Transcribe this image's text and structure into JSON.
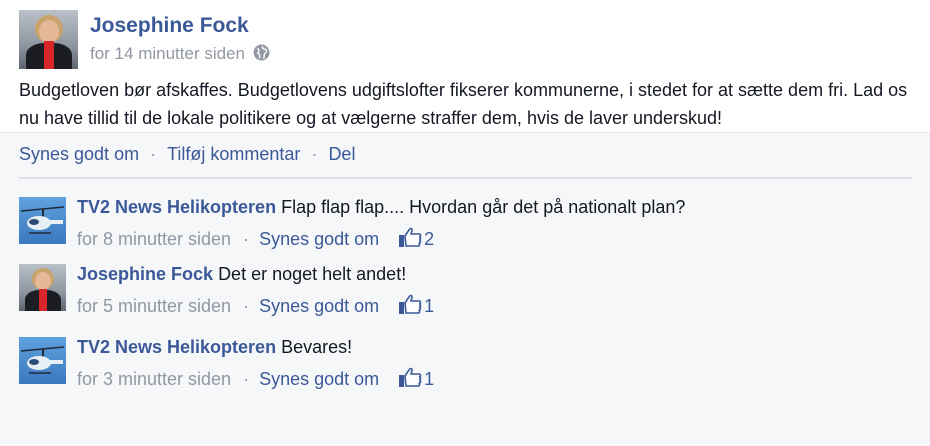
{
  "post": {
    "author": "Josephine Fock",
    "time": "for 14 minutter siden",
    "privacy_icon": "globe-icon",
    "text": "Budgetloven bør afskaffes. Budgetlovens udgiftslofter fikserer kommunerne, i stedet for at sætte dem fri. Lad os nu have tillid til de lokale politikere og at vælgerne straffer dem, hvis de laver underskud!"
  },
  "actions": {
    "like": "Synes godt om",
    "comment": "Tilføj kommentar",
    "share": "Del",
    "separator": "·"
  },
  "comments": [
    {
      "author": "TV2 News Helikopteren",
      "text": "Flap flap flap....  Hvordan går det på nationalt plan?",
      "time": "for 8 minutter siden",
      "like_label": "Synes godt om",
      "likes": "2",
      "avatar": "helicopter"
    },
    {
      "author": "Josephine Fock",
      "text": "Det er noget helt andet!",
      "time": "for 5 minutter siden",
      "like_label": "Synes godt om",
      "likes": "1",
      "avatar": "person"
    },
    {
      "author": "TV2 News Helikopteren",
      "text": "Bevares!",
      "time": "for 3 minutter siden",
      "like_label": "Synes godt om",
      "likes": "1",
      "avatar": "helicopter"
    }
  ],
  "colors": {
    "link": "#3b5998",
    "meta": "#9197a3",
    "text": "#141823",
    "comment_bg": "#f6f7f9"
  }
}
